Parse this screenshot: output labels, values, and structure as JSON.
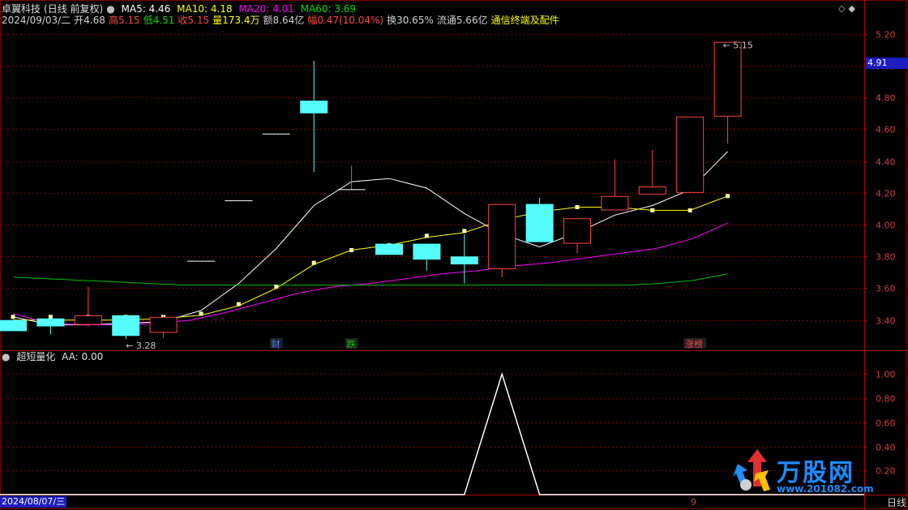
{
  "header": {
    "stock_name": "卓翼科技",
    "period_mode": "(日线 前复权)",
    "ma5_label": "MA5: 4.46",
    "ma10_label": "MA10: 4.18",
    "ma20_label": "MA20: 4.01",
    "ma60_label": "MA60: 3.69",
    "date": "2024/09/03/二",
    "open_label": "开4.68",
    "high_label": "高5.15",
    "low_label": "低4.51",
    "close_label": "收5.15",
    "volume_label": "量173.4万",
    "amount_label": "额8.64亿",
    "change_label": "幅0.47(10.04%)",
    "turnover_label": "换30.65%",
    "float_label": "流通5.66亿",
    "concept_label": "通信终端及配件"
  },
  "indicator": {
    "name": "超短量化",
    "aa_label": "AA: 0.00"
  },
  "footer": {
    "date_left": "2024/08/07/三",
    "period_btn": "日线",
    "cursor_num": "9"
  },
  "price_badge": "4.91",
  "watermark": {
    "brand": "万股网",
    "url": "www.201082.com"
  },
  "colors": {
    "up": "#ff4444",
    "down": "#54fcfc",
    "ma5": "#ffffff",
    "ma10": "#ffff00",
    "ma20": "#ff00ff",
    "ma60": "#00c000",
    "grid": "#800000",
    "axis_text": "#d04040"
  },
  "chart_data": [
    {
      "type": "candlestick",
      "title": "卓翼科技",
      "ylim": [
        3.22,
        5.26
      ],
      "yticks": [
        "5.20",
        "5.00",
        "4.80",
        "4.60",
        "4.40",
        "4.20",
        "4.00",
        "3.80",
        "3.60",
        "3.40"
      ],
      "candles": [
        {
          "o": 3.4,
          "h": 3.4,
          "l": 3.33,
          "c": 3.33
        },
        {
          "o": 3.41,
          "h": 3.41,
          "l": 3.31,
          "c": 3.36
        },
        {
          "o": 3.37,
          "h": 3.61,
          "l": 3.36,
          "c": 3.43
        },
        {
          "o": 3.43,
          "h": 3.43,
          "l": 3.28,
          "c": 3.3
        },
        {
          "o": 3.32,
          "h": 3.43,
          "l": 3.29,
          "c": 3.42
        },
        {
          "o": 3.77,
          "h": 3.77,
          "l": 3.77,
          "c": 3.77
        },
        {
          "o": 4.15,
          "h": 4.15,
          "l": 4.15,
          "c": 4.15
        },
        {
          "o": 4.57,
          "h": 4.57,
          "l": 4.57,
          "c": 4.57
        },
        {
          "o": 4.78,
          "h": 5.03,
          "l": 4.33,
          "c": 4.7
        },
        {
          "o": 4.22,
          "h": 4.37,
          "l": 4.22,
          "c": 4.22
        },
        {
          "o": 3.88,
          "h": 3.88,
          "l": 3.81,
          "c": 3.81
        },
        {
          "o": 3.88,
          "h": 3.88,
          "l": 3.71,
          "c": 3.78
        },
        {
          "o": 3.8,
          "h": 3.94,
          "l": 3.63,
          "c": 3.75
        },
        {
          "o": 3.72,
          "h": 4.13,
          "l": 3.67,
          "c": 4.13
        },
        {
          "o": 4.13,
          "h": 4.17,
          "l": 3.89,
          "c": 3.89
        },
        {
          "o": 3.88,
          "h": 4.04,
          "l": 3.82,
          "c": 4.04
        },
        {
          "o": 4.09,
          "h": 4.41,
          "l": 4.09,
          "c": 4.18
        },
        {
          "o": 4.19,
          "h": 4.47,
          "l": 4.19,
          "c": 4.24
        },
        {
          "o": 4.2,
          "h": 4.68,
          "l": 4.2,
          "c": 4.68
        },
        {
          "o": 4.68,
          "h": 5.15,
          "l": 4.51,
          "c": 5.15
        }
      ],
      "series": [
        {
          "name": "MA5",
          "values": [
            3.42,
            3.37,
            3.37,
            3.38,
            3.39,
            3.46,
            3.63,
            3.85,
            4.12,
            4.27,
            4.29,
            4.23,
            4.07,
            3.94,
            3.86,
            3.95,
            4.06,
            4.12,
            4.22,
            4.46
          ]
        },
        {
          "name": "MA10",
          "values": [
            3.4,
            3.4,
            3.4,
            3.4,
            3.41,
            3.43,
            3.49,
            3.6,
            3.75,
            3.84,
            3.87,
            3.92,
            3.95,
            4.03,
            4.08,
            4.11,
            4.11,
            4.09,
            4.09,
            4.18
          ]
        },
        {
          "name": "MA20",
          "values": [
            3.44,
            3.38,
            3.37,
            3.37,
            3.38,
            3.4,
            3.45,
            3.51,
            3.57,
            3.61,
            3.63,
            3.66,
            3.69,
            3.71,
            3.74,
            3.76,
            3.79,
            3.82,
            3.85,
            3.91,
            4.01
          ]
        },
        {
          "name": "MA60",
          "values": [
            3.67,
            3.66,
            3.65,
            3.64,
            3.63,
            3.62,
            3.62,
            3.62,
            3.62,
            3.62,
            3.62,
            3.62,
            3.62,
            3.62,
            3.62,
            3.62,
            3.62,
            3.62,
            3.62,
            3.63,
            3.65,
            3.69
          ]
        },
        {
          "name": "MA10_marker_points",
          "values": [
            3.42,
            3.42,
            3.42,
            3.42,
            3.42,
            3.44,
            3.5,
            3.61,
            3.76,
            3.84,
            3.87,
            3.93,
            3.96,
            4.04,
            4.09,
            4.11,
            4.11,
            4.09,
            4.09,
            4.18
          ]
        }
      ],
      "annotations": [
        {
          "text": "3.28",
          "candle": 3
        },
        {
          "text": "5.15",
          "candle": 19
        },
        {
          "text": "财",
          "candle": 7
        },
        {
          "text": "跌",
          "candle": 9
        },
        {
          "text": "涨榜",
          "candle": 18
        }
      ]
    },
    {
      "type": "line",
      "title": "超短量化",
      "ylim": [
        0,
        1.05
      ],
      "yticks": [
        "1.00",
        "0.80",
        "0.60",
        "0.40",
        "0.20"
      ],
      "series": [
        {
          "name": "AA",
          "values": [
            0,
            0,
            0,
            0,
            0,
            0,
            0,
            0,
            0,
            0,
            0,
            0,
            0,
            1.0,
            0,
            0,
            0,
            0,
            0,
            0
          ]
        }
      ]
    }
  ]
}
